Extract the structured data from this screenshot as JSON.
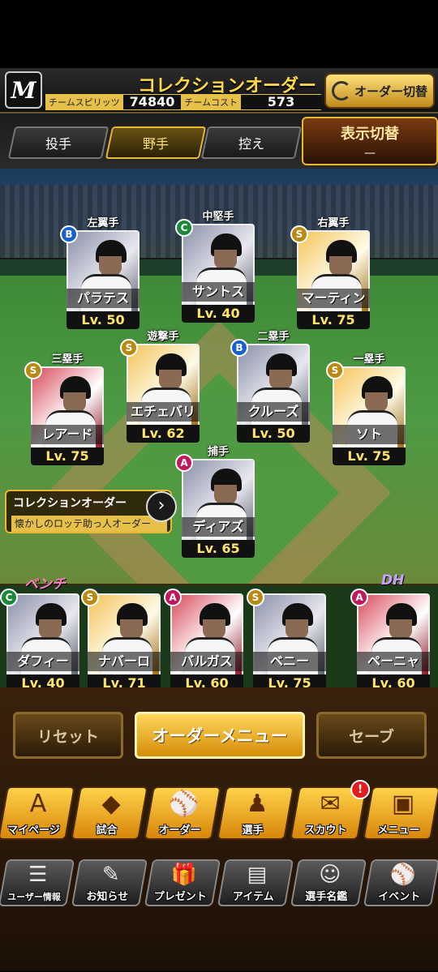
{
  "header": {
    "logo": "M",
    "title": "コレクションオーダー",
    "team_spirits_label": "チームスピリッツ",
    "team_spirits_value": "74840",
    "team_cost_label": "チームコスト",
    "team_cost_value": "573",
    "order_switch_label": "オーダー切替"
  },
  "tabs": [
    {
      "label": "投手",
      "active": false
    },
    {
      "label": "野手",
      "active": true
    },
    {
      "label": "控え",
      "active": false
    }
  ],
  "display_switch": {
    "title": "表示切替",
    "value": "—"
  },
  "lineup": [
    {
      "position": "左翼手",
      "rank": "B",
      "name": "パラテス",
      "level": "Lv. 50"
    },
    {
      "position": "中堅手",
      "rank": "C",
      "name": "サントス",
      "level": "Lv. 40"
    },
    {
      "position": "右翼手",
      "rank": "S",
      "name": "マーティン",
      "level": "Lv. 75"
    },
    {
      "position": "遊撃手",
      "rank": "S",
      "name": "エチェバリア",
      "level": "Lv. 62"
    },
    {
      "position": "二塁手",
      "rank": "B",
      "name": "クルーズ",
      "level": "Lv. 50"
    },
    {
      "position": "三塁手",
      "rank": "S",
      "name": "レアード",
      "level": "Lv. 75"
    },
    {
      "position": "一塁手",
      "rank": "S",
      "name": "ソト",
      "level": "Lv. 75"
    },
    {
      "position": "捕手",
      "rank": "A",
      "name": "ディアズ",
      "level": "Lv. 65"
    }
  ],
  "collection_order": {
    "title": "コレクションオーダー",
    "subtitle": "懐かしのロッテ助っ人オーダー"
  },
  "bench_label": "ベンチ",
  "dh_label": "DH",
  "bench": [
    {
      "rank": "C",
      "name": "ダフィー",
      "level": "Lv. 40"
    },
    {
      "rank": "S",
      "name": "ナバーロ",
      "level": "Lv. 71"
    },
    {
      "rank": "A",
      "name": "バルガス",
      "level": "Lv. 60"
    },
    {
      "rank": "S",
      "name": "ベニー",
      "level": "Lv. 75"
    }
  ],
  "dh": {
    "rank": "A",
    "name": "ペーニャ",
    "level": "Lv. 60"
  },
  "actions": {
    "reset": "リセット",
    "order_menu": "オーダーメニュー",
    "save": "セーブ"
  },
  "nav_primary": [
    {
      "label": "マイページ",
      "icon": "A"
    },
    {
      "label": "試合",
      "icon": "◆"
    },
    {
      "label": "オーダー",
      "icon": "⚾"
    },
    {
      "label": "選手",
      "icon": "♟"
    },
    {
      "label": "スカウト",
      "icon": "✉",
      "badge": "!"
    },
    {
      "label": "メニュー",
      "icon": "▣"
    }
  ],
  "nav_secondary": [
    {
      "label": "ユーザー情報",
      "icon": "☰"
    },
    {
      "label": "お知らせ",
      "icon": "✎"
    },
    {
      "label": "プレゼント",
      "icon": "🎁"
    },
    {
      "label": "アイテム",
      "icon": "▤"
    },
    {
      "label": "選手名鑑",
      "icon": "☺"
    },
    {
      "label": "イベント",
      "icon": "⚾"
    }
  ]
}
